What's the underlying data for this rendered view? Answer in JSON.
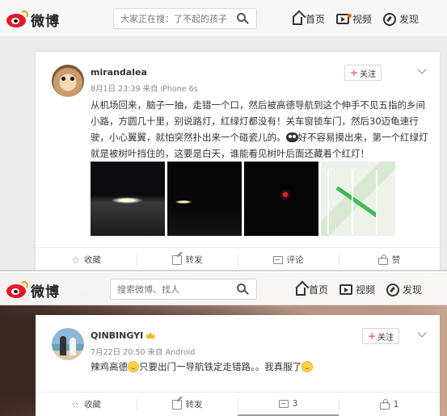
{
  "header_top": {
    "logo_text": "微博",
    "search_placeholder": "大家正在搜：了不起的孩子",
    "nav": [
      {
        "label": "首页",
        "icon": "home-icon",
        "badge": false
      },
      {
        "label": "视频",
        "icon": "video-icon",
        "badge": true
      },
      {
        "label": "发现",
        "icon": "compass-icon",
        "badge": false
      }
    ]
  },
  "post1": {
    "username": "mirandalea",
    "meta": "8月1日 23:39 来自 iPhone 6s",
    "follow_label": "关注",
    "text_part1": "从机场回来，脑子一抽，走错一个口，然后被高德导航到这个伸手不见五指的乡间小路，方圆几十里，别说路灯，红绿灯都没有！关车窗锁车门，然后30迈龟速行驶，小心翼翼，就怕突然扑出来一个碰瓷儿的。",
    "text_part2": "好不容易摸出来，第一个红绿灯就是被树叶挡住的，这要是白天，谁能看见树叶后面还藏着个红灯！",
    "photos": [
      "night-road-photo",
      "dark-car-photo",
      "red-light-photo",
      "navigation-map-photo"
    ],
    "actions": [
      {
        "label": "收藏",
        "icon": "star-icon"
      },
      {
        "label": "转发",
        "icon": "share-icon"
      },
      {
        "label": "评论",
        "icon": "comment-icon"
      },
      {
        "label": "赞",
        "icon": "like-icon"
      }
    ]
  },
  "header_bottom": {
    "logo_text": "微博",
    "search_placeholder": "搜索微博、找人",
    "nav": [
      {
        "label": "首页",
        "icon": "home-icon"
      },
      {
        "label": "视频",
        "icon": "video-icon"
      },
      {
        "label": "发现",
        "icon": "compass-icon"
      }
    ]
  },
  "post2": {
    "username": "QINBINGYI",
    "meta": "7月22日 20:50 来自 Android",
    "follow_label": "关注",
    "text_part1": "辣鸡高德",
    "text_part2": "只要出门一导航铁定走错路。。我真服了",
    "actions": [
      {
        "label": "收藏",
        "icon": "star-icon"
      },
      {
        "label": "转发",
        "icon": "share-icon"
      },
      {
        "label": "3",
        "icon": "comment-icon"
      },
      {
        "label": "1",
        "icon": "like-icon"
      }
    ]
  },
  "colors": {
    "brand_red": "#e6162d",
    "brand_orange": "#f39800",
    "follow_plus": "#ff6666"
  }
}
